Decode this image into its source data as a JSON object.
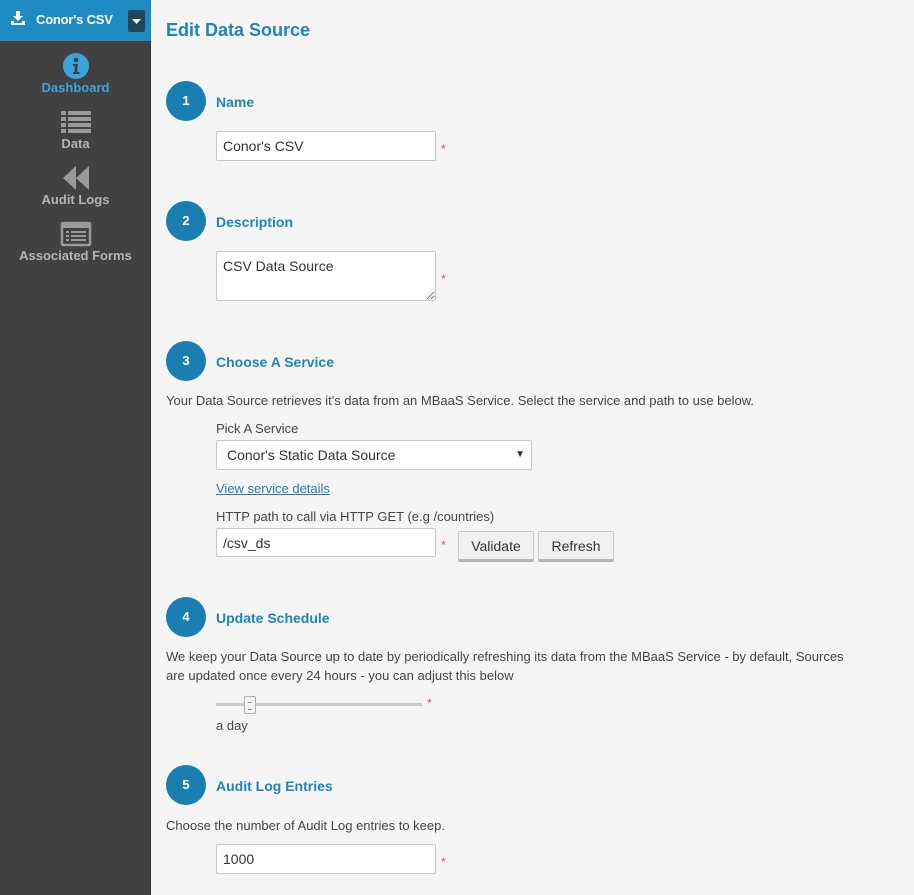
{
  "app": {
    "title": "Conor's CSV"
  },
  "nav": {
    "items": [
      {
        "label": "Dashboard",
        "icon": "info-icon",
        "active": true
      },
      {
        "label": "Data",
        "icon": "list-icon",
        "active": false
      },
      {
        "label": "Audit Logs",
        "icon": "rewind-icon",
        "active": false
      },
      {
        "label": "Associated Forms",
        "icon": "form-icon",
        "active": false
      }
    ]
  },
  "page": {
    "title": "Edit Data Source"
  },
  "steps": {
    "name": {
      "number": "1",
      "title": "Name",
      "value": "Conor's CSV"
    },
    "description": {
      "number": "2",
      "title": "Description",
      "value": "CSV Data Source"
    },
    "service": {
      "number": "3",
      "title": "Choose A Service",
      "description": "Your Data Source retrieves it's data from an MBaaS Service. Select the service and path to use below.",
      "pick_label": "Pick A Service",
      "selected_service": "Conor's Static Data Source",
      "details_link": "View service details",
      "path_label": "HTTP path to call via HTTP GET (e.g /countries)",
      "path_value": "/csv_ds",
      "validate_label": "Validate",
      "refresh_label": "Refresh"
    },
    "schedule": {
      "number": "4",
      "title": "Update Schedule",
      "description_line1": "We keep your Data Source up to date by periodically refreshing its data from the MBaaS Service - by default, Sources",
      "description_line2": "are updated once every 24 hours - you can adjust this below",
      "value_label": "a day"
    },
    "audit": {
      "number": "5",
      "title": "Audit Log Entries",
      "description": "Choose the number of Audit Log entries to keep.",
      "value": "1000"
    }
  },
  "required_mark": "*",
  "colors": {
    "accent": "#1f85b8",
    "header": "#1e8cc2",
    "sidebar": "#414141",
    "required": "#d9534f"
  }
}
